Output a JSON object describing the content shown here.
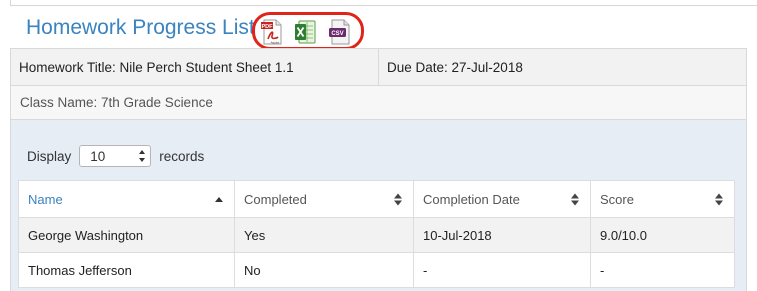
{
  "page_title": "Homework Progress List",
  "export": {
    "pdf_label": "PDF",
    "pdf_sub": "Adobe",
    "csv_label": "CSV"
  },
  "homework": {
    "title_text": "Homework Title: Nile Perch Student Sheet 1.1",
    "due_text": "Due Date: 27-Jul-2018",
    "class_text": "Class Name: 7th Grade Science"
  },
  "length_control": {
    "prefix": "Display",
    "value": "10",
    "suffix": "records"
  },
  "table": {
    "columns": [
      "Name",
      "Completed",
      "Completion Date",
      "Score"
    ],
    "rows": [
      [
        "George Washington",
        "Yes",
        "10-Jul-2018",
        "9.0/10.0"
      ],
      [
        "Thomas Jefferson",
        "No",
        "-",
        "-"
      ]
    ]
  },
  "colors": {
    "accent": "#3a83c1",
    "highlight_ring": "#e0241a",
    "panel_bg": "#e6edf5"
  }
}
